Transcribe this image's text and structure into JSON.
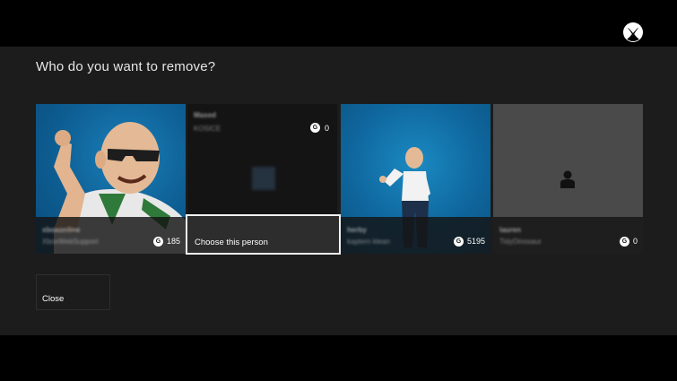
{
  "dialog": {
    "title": "Who do you want to remove?",
    "choose_label": "Choose this person",
    "close_label": "Close"
  },
  "profiles": [
    {
      "name": "xboxonline",
      "subtitle": "XboxWebSupport",
      "gamerscore": "185",
      "avatar": "avatar-man-sunglasses"
    },
    {
      "name": "Maxed",
      "subtitle": "KOSICE",
      "gamerscore": "0",
      "avatar": "blurred-small-avatar"
    },
    {
      "name": "herby",
      "subtitle": "kaptern klean",
      "gamerscore": "5195",
      "avatar": "avatar-standing-waving"
    },
    {
      "name": "lauren",
      "subtitle": "TidyDinosaur",
      "gamerscore": "0",
      "avatar": "person-silhouette-icon"
    }
  ],
  "gamerscore_glyph": "G",
  "colors": {
    "background": "#1c1c1c",
    "accent_tile": "#0f679e",
    "focus_border": "#f2f2f2"
  },
  "icons": {
    "brand": "xbox-logo-icon"
  }
}
